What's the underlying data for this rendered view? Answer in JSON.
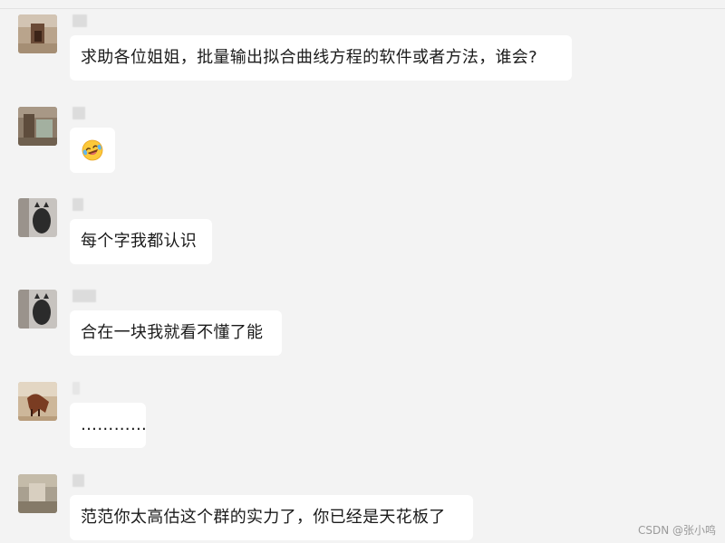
{
  "chat": {
    "messages": [
      {
        "sender_avatar": "avatar-1",
        "text": "求助各位姐姐，批量输出拟合曲线方程的软件或者方法，谁会?"
      },
      {
        "sender_avatar": "avatar-2",
        "emoji": "laughing-crying-emoji",
        "text": ""
      },
      {
        "sender_avatar": "avatar-3",
        "text": "每个字我都认识"
      },
      {
        "sender_avatar": "avatar-3",
        "text": "合在一块我就看不懂了能"
      },
      {
        "sender_avatar": "avatar-4",
        "text": "…………"
      },
      {
        "sender_avatar": "avatar-5",
        "text": "范范你太高估这个群的实力了，你已经是天花板了"
      }
    ]
  },
  "watermark": {
    "text": "CSDN @张小鸣"
  },
  "colors": {
    "background": "#f3f3f3",
    "bubble": "#ffffff",
    "text": "#1b1b1b"
  }
}
